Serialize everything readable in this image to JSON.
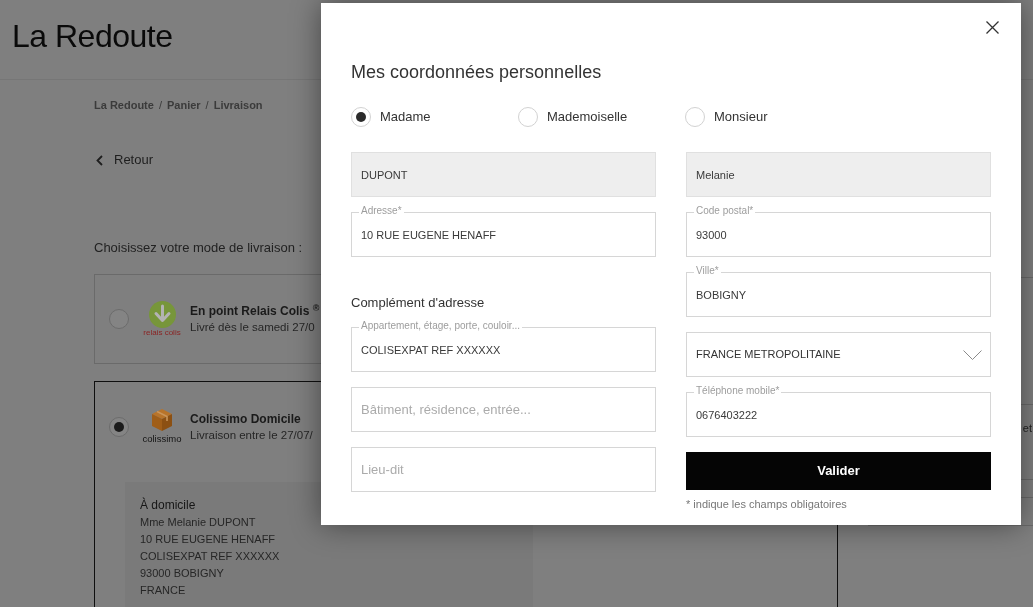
{
  "page": {
    "logo": "La Redoute",
    "breadcrumb": [
      {
        "label": "La Redoute",
        "separator": "/"
      },
      {
        "label": "Panier",
        "separator": "/"
      },
      {
        "label": "Livraison"
      }
    ],
    "back_link": "Retour",
    "delivery_prompt": "Choisissez votre mode de livraison :",
    "delivery_options": [
      {
        "kind": "relay",
        "logo_text": "relais colis",
        "name": "En point Relais Colis $^{®}$",
        "detail": "Livré dès le samedi 27/0",
        "selected": false
      },
      {
        "kind": "home",
        "logo_text": "colissimo",
        "name": "Colissimo Domicile",
        "detail": "Livraison entre le 27/07/",
        "selected": true,
        "address": {
          "heading": "À domicile",
          "lines": [
            "Mme Melanie DUPONT",
            "10 RUE EUGENE HENAFF",
            "COLISEXPAT REF XXXXXX",
            "93000 BOBIGNY",
            "FRANCE"
          ]
        }
      }
    ],
    "side_panel": {
      "text": "et"
    }
  },
  "modal": {
    "title": "Mes coordonnées personnelles",
    "civility": [
      {
        "label": "Madame",
        "selected": true
      },
      {
        "label": "Mademoiselle",
        "selected": false
      },
      {
        "label": "Monsieur",
        "selected": false
      }
    ],
    "left_column": [
      {
        "kind": "field",
        "value": "DUPONT",
        "disabled": true
      },
      {
        "kind": "field",
        "label": "Adresse*",
        "value": "10 RUE EUGENE HENAFF",
        "disabled": false
      },
      {
        "kind": "heading",
        "text": "Complément d'adresse"
      },
      {
        "kind": "field",
        "label": "Appartement, étage, porte, couloir...",
        "value": "COLISEXPAT REF XXXXXX",
        "disabled": false
      },
      {
        "kind": "field",
        "placeholder": "Bâtiment, résidence, entrée...",
        "disabled": false
      },
      {
        "kind": "field",
        "placeholder": "Lieu-dit",
        "disabled": false
      }
    ],
    "right_column": [
      {
        "kind": "field",
        "value": "Melanie",
        "disabled": true
      },
      {
        "kind": "field",
        "label": "Code postal*",
        "value": "93000",
        "disabled": false
      },
      {
        "kind": "field",
        "label": "Ville*",
        "value": "BOBIGNY",
        "disabled": false
      },
      {
        "kind": "select",
        "value": "FRANCE METROPOLITAINE",
        "disabled": false
      },
      {
        "kind": "field",
        "label": "Téléphone mobile*",
        "value": "0676403222",
        "disabled": false
      },
      {
        "kind": "button",
        "label": "Valider"
      },
      {
        "kind": "note",
        "text": "* indique les champs obligatoires"
      }
    ]
  }
}
